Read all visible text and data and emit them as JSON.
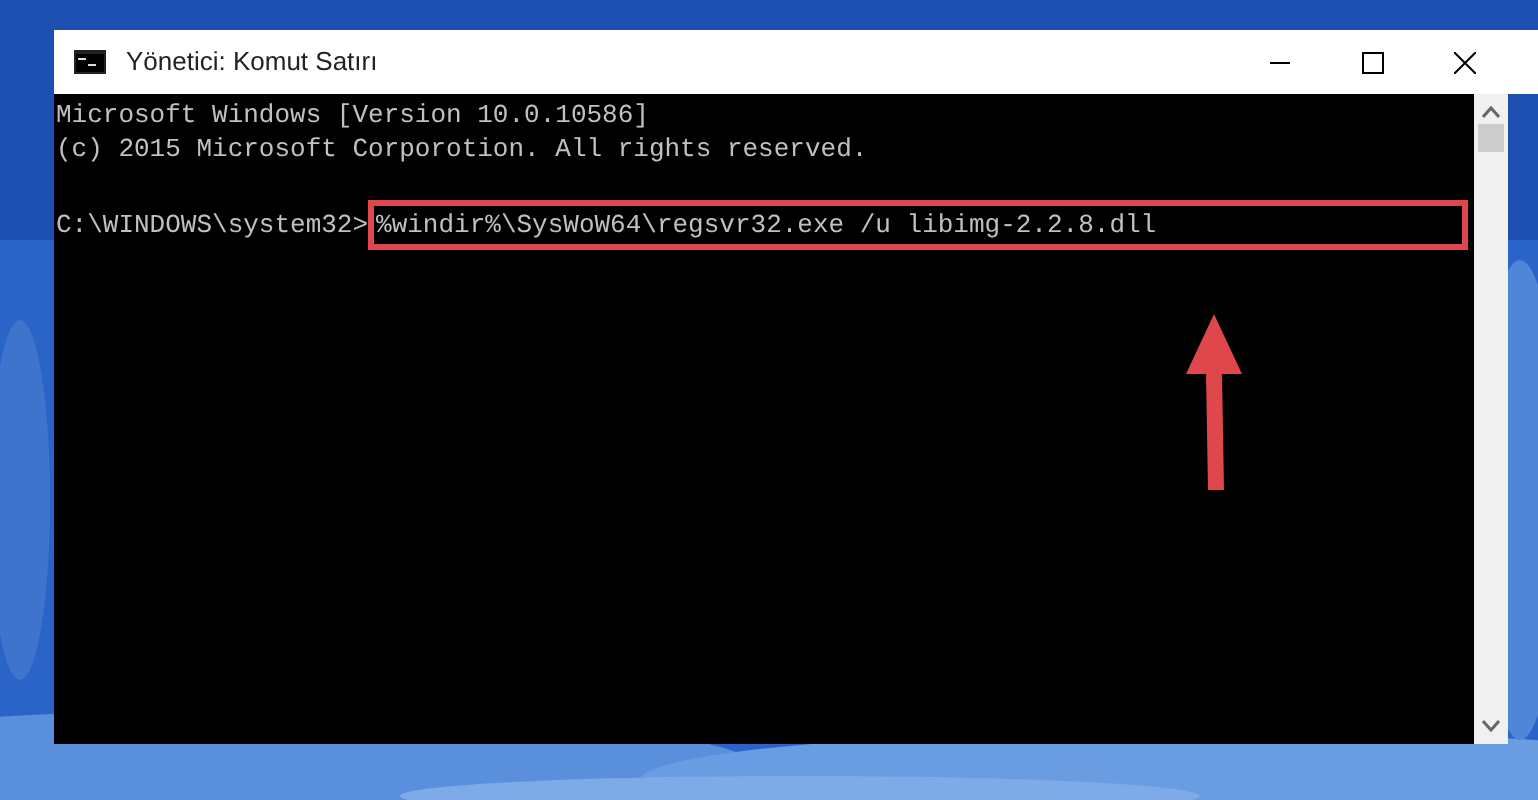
{
  "window": {
    "title": "Yönetici: Komut Satırı"
  },
  "console": {
    "lines": [
      "Microsoft Windows [Version 10.0.10586]",
      "(c) 2015 Microsoft Corporotion. All rights reserved."
    ],
    "prompt": "C:\\WINDOWS\\system32>",
    "command": {
      "text": "%windir%\\SysWoW64\\regsvr32.exe /u libimg-2.2.8.dll",
      "highlighted": true
    }
  }
}
